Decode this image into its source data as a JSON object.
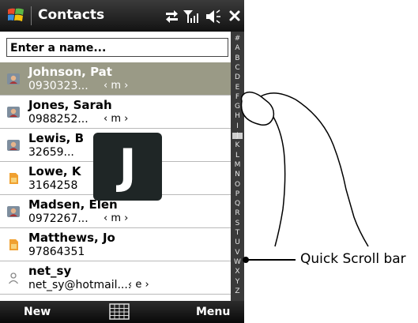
{
  "title_bar": {
    "app_title": "Contacts"
  },
  "search": {
    "placeholder": "Enter a name..."
  },
  "contacts": [
    {
      "name": "Johnson, Pat",
      "detail": "0930323...",
      "selector": "‹ m ›",
      "type": "contact"
    },
    {
      "name": "Jones, Sarah",
      "detail": "0988252...",
      "selector": "‹ m ›",
      "type": "contact"
    },
    {
      "name": "Lewis, B",
      "detail": "32659...",
      "selector": "",
      "type": "contact"
    },
    {
      "name": "Lowe, K",
      "detail": "3164258",
      "selector": "",
      "type": "sim"
    },
    {
      "name": "Madsen, Elen",
      "detail": "0972267...",
      "selector": "‹ m ›",
      "type": "contact"
    },
    {
      "name": "Matthews, Jo",
      "detail": "97864351",
      "selector": "",
      "type": "sim"
    },
    {
      "name": "net_sy",
      "detail": "net_sy@hotmail....",
      "selector": "‹ e ›",
      "type": "email"
    }
  ],
  "quick_scroll": {
    "letters": [
      "#",
      "A",
      "B",
      "C",
      "D",
      "E",
      "F",
      "G",
      "H",
      "I",
      "J",
      "K",
      "L",
      "M",
      "N",
      "O",
      "P",
      "Q",
      "R",
      "S",
      "T",
      "U",
      "V",
      "W",
      "X",
      "Y",
      "Z"
    ]
  },
  "popup_letter": "J",
  "bottom_bar": {
    "left_soft_key": "New",
    "right_soft_key": "Menu"
  },
  "callout": {
    "label": "Quick Scroll bar"
  },
  "colors": {
    "selected_row": "#9a9a86",
    "title_bar": "#1e1e1e",
    "popup_bg": "#1f2626"
  }
}
